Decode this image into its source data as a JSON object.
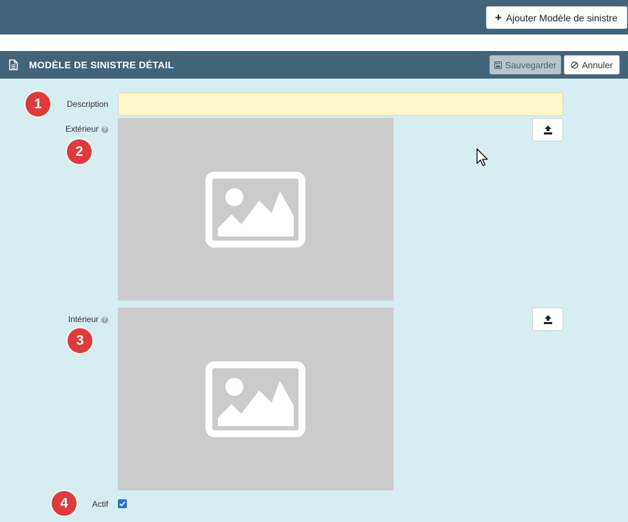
{
  "toolbar": {
    "add_label": "Ajouter Modèle de sinistre",
    "add_icon": "plus-icon"
  },
  "panel": {
    "title": "MODÈLE DE SINISTRE DÉTAIL",
    "title_icon": "document-icon",
    "save_label": "Sauvegarder",
    "cancel_label": "Annuler"
  },
  "form": {
    "description_label": "Description",
    "description_value": "",
    "exterior_label": "Extérieur",
    "interior_label": "Intérieur",
    "help_glyph": "?",
    "actif_label": "Actif",
    "actif_checked": true
  },
  "annotations": [
    "1",
    "2",
    "3",
    "4"
  ],
  "colors": {
    "header": "#41647a",
    "body": "#d6edf1",
    "input_bg": "#fdf7c8",
    "placeholder": "#cbcbcb",
    "badge": "#e03a3a",
    "checkbox": "#1a73e8"
  }
}
